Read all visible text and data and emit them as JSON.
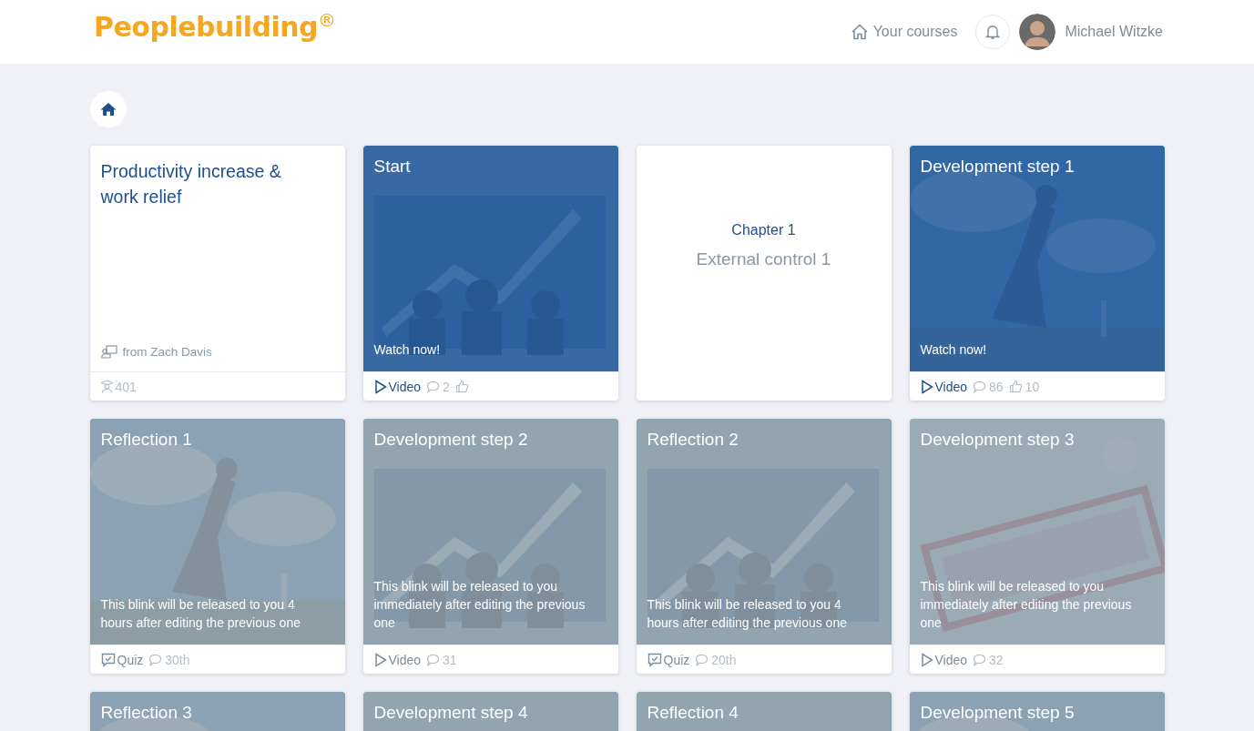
{
  "header": {
    "logo": "Peoplebuilding$^{®}$",
    "nav_link": "Your courses",
    "user_name": "Michael Witzke"
  },
  "cards": [
    {
      "kind": "course",
      "title": "Productivity increase & work relief",
      "author": "from Zach Davis",
      "learners": "401"
    },
    {
      "kind": "blink",
      "title": "Start",
      "locked": false,
      "message": "Watch now!",
      "media": {
        "kind": "video",
        "label": "Video"
      },
      "comments": "2"
    },
    {
      "kind": "chapter",
      "label": "Chapter 1",
      "title": "External control 1"
    },
    {
      "kind": "blink",
      "title": "Development step 1",
      "locked": false,
      "message": "Watch now!",
      "media": {
        "kind": "video",
        "label": "Video"
      },
      "comments": "86",
      "likes": "10"
    },
    {
      "kind": "blink",
      "title": "Reflection 1",
      "locked": true,
      "message": "This blink will be released to you 4 hours after editing the previous one",
      "media": {
        "kind": "quiz",
        "label": "Quiz"
      },
      "comments": "30th"
    },
    {
      "kind": "blink",
      "title": "Development step 2",
      "locked": true,
      "message": "This blink will be released to you immediately after editing the previous one",
      "media": {
        "kind": "video",
        "label": "Video"
      },
      "comments": "31"
    },
    {
      "kind": "blink",
      "title": "Reflection 2",
      "locked": true,
      "message": "This blink will be released to you 4 hours after editing the previous one",
      "media": {
        "kind": "quiz",
        "label": "Quiz"
      },
      "comments": "20th"
    },
    {
      "kind": "blink",
      "title": "Development step 3",
      "locked": true,
      "message": "This blink will be released to you immediately after editing the previous one",
      "media": {
        "kind": "video",
        "label": "Video"
      },
      "comments": "32"
    },
    {
      "kind": "blink",
      "title": "Reflection 3",
      "locked": true
    },
    {
      "kind": "blink",
      "title": "Development step 4",
      "locked": true
    },
    {
      "kind": "blink",
      "title": "Reflection 4",
      "locked": true
    },
    {
      "kind": "blink",
      "title": "Development step 5",
      "locked": true
    }
  ]
}
